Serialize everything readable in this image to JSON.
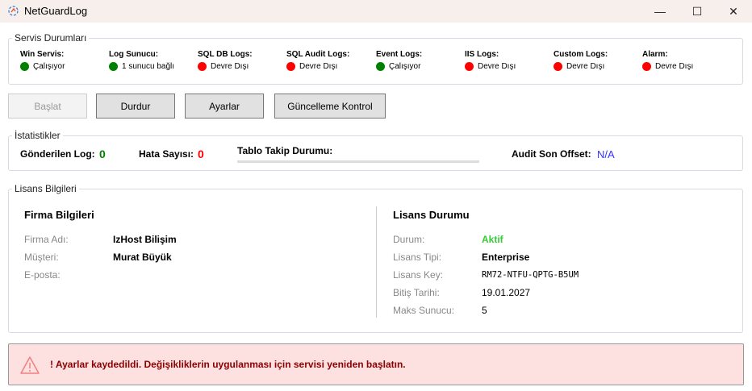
{
  "window": {
    "title": "NetGuardLog",
    "minimize": "—",
    "maximize": "☐",
    "close": "✕"
  },
  "colors": {
    "running": "#008000",
    "disabled": "#ff0000",
    "accent": "#3333ff",
    "active": "#33cc33",
    "alert_text": "#8b0000",
    "alert_bg": "#fde0e0"
  },
  "services": {
    "title": "Servis Durumları",
    "items": [
      {
        "label": "Win Servis:",
        "status": "Çalışıyor",
        "state": "running"
      },
      {
        "label": "Log Sunucu:",
        "status": "1 sunucu bağlı",
        "state": "running"
      },
      {
        "label": "SQL DB Logs:",
        "status": "Devre Dışı",
        "state": "disabled"
      },
      {
        "label": "SQL Audit Logs:",
        "status": "Devre Dışı",
        "state": "disabled"
      },
      {
        "label": "Event Logs:",
        "status": "Çalışıyor",
        "state": "running"
      },
      {
        "label": "IIS Logs:",
        "status": "Devre Dışı",
        "state": "disabled"
      },
      {
        "label": "Custom Logs:",
        "status": "Devre Dışı",
        "state": "disabled"
      },
      {
        "label": "Alarm:",
        "status": "Devre Dışı",
        "state": "disabled"
      }
    ]
  },
  "toolbar": {
    "start": "Başlat",
    "stop": "Durdur",
    "settings": "Ayarlar",
    "update": "Güncelleme Kontrol"
  },
  "stats": {
    "title": "İstatistikler",
    "sent_label": "Gönderilen Log:",
    "sent": "0",
    "errors_label": "Hata Sayısı:",
    "errors": "0",
    "table_label": "Tablo Takip Durumu:",
    "table_progress": 0,
    "audit_label": "Audit Son Offset:",
    "audit": "N/A"
  },
  "license": {
    "title": "Lisans Bilgileri",
    "company": {
      "heading": "Firma Bilgileri",
      "rows": [
        {
          "label": "Firma Adı:",
          "value": "IzHost Bilişim"
        },
        {
          "label": "Müşteri:",
          "value": "Murat Büyük"
        },
        {
          "label": "E-posta:",
          "value": ""
        }
      ]
    },
    "status": {
      "heading": "Lisans Durumu",
      "rows": [
        {
          "label": "Durum:",
          "value": "Aktif"
        },
        {
          "label": "Lisans Tipi:",
          "value": "Enterprise"
        },
        {
          "label": "Lisans Key:",
          "value": "RM72-NTFU-QPTG-B5UM"
        },
        {
          "label": "Bitiş Tarihi:",
          "value": "19.01.2027"
        },
        {
          "label": "Maks Sunucu:",
          "value": "5"
        }
      ]
    }
  },
  "alert": {
    "message": "! Ayarlar kaydedildi. Değişikliklerin uygulanması için servisi yeniden başlatın."
  }
}
